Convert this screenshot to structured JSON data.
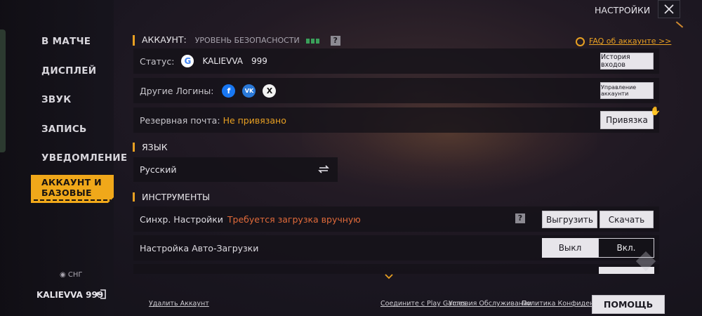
{
  "header": {
    "title": "НАСТРОЙКИ"
  },
  "sidebar": {
    "items": [
      {
        "label": "В МАТЧЕ"
      },
      {
        "label": "ДИСПЛЕЙ"
      },
      {
        "label": "ЗВУК"
      },
      {
        "label": "ЗАПИСЬ"
      },
      {
        "label": "УВЕДОМЛЕНИЕ"
      },
      {
        "label": "АККАУНТ И БАЗОВЫЕ",
        "active": true
      }
    ],
    "region": "СНГ",
    "user": "KALIEVVA 999"
  },
  "account": {
    "heading": "АККАУНТ:",
    "security_label": "УРОВЕНЬ БЕЗОПАСНОСТИ",
    "faq_link": "FAQ об аккаунте >>",
    "status_label": "Статус:",
    "provider_icon": "google-icon",
    "username": "KALIEVVA",
    "user_number": "999",
    "login_history_button": "История входов",
    "other_logins_label": "Другие Логины:",
    "manage_accounts_button": "Управление аккаунти",
    "backup_mail_label": "Резервная почта:",
    "backup_mail_value": "Не привязано",
    "bind_button": "Привязка"
  },
  "language": {
    "heading": "ЯЗЫК",
    "current": "Русский"
  },
  "tools": {
    "heading": "ИНСТРУМЕНТЫ",
    "sync_label": "Синхр. Настройки",
    "sync_status": "Требуется загрузка вручную",
    "upload_button": "Выгрузить",
    "download_button": "Скачать",
    "autoload_label": "Настройка Авто-Загрузки",
    "off_label": "Выкл",
    "on_label": "Вкл."
  },
  "footer": {
    "delete_account": "Удалить Аккаунт",
    "link_play_games": "Соедините с Play Games",
    "terms": "Условия Обслуживании",
    "privacy": "Политика Конфиденц.",
    "help_button": "ПОМОЩЬ"
  },
  "colors": {
    "accent": "#e8a022",
    "warning": "#e06a3a",
    "security_bar": "#3aa05a"
  }
}
